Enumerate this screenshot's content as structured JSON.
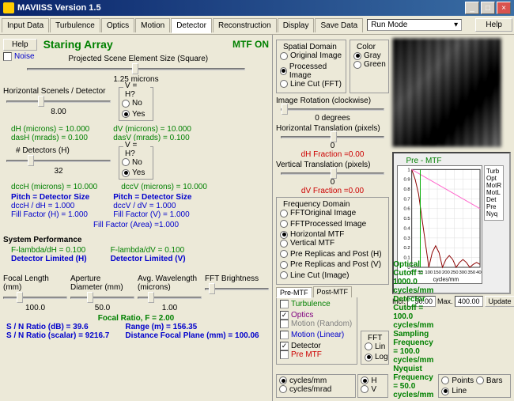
{
  "window": {
    "title": "MAVIISS Version 1.5",
    "help": "Help"
  },
  "tabs": [
    "Input Data",
    "Turbulence",
    "Optics",
    "Motion",
    "Detector",
    "Reconstruction",
    "Display",
    "Save Data"
  ],
  "active_tab": "Detector",
  "runmode": "Run Mode",
  "left": {
    "help": "Help",
    "title": "Staring Array",
    "mtf": "MTF ON",
    "noise": "Noise",
    "projected_label": "Projected Scene Element Size (Square)",
    "projected_val": "1.25 microns",
    "h_scenels": "Horizontal Scenels / Detector",
    "vh_label": "V = H?",
    "vh_no": "No",
    "vh_yes": "Yes",
    "h_scenels_val": "8.00",
    "dH": "dH (microns) = 10.000",
    "dV": "dV (microns) = 10.000",
    "dasH": "dasH (mrads) = 0.100",
    "dasV": "dasV (mrads) = 0.100",
    "ndetectors": "# Detectors (H)",
    "ndetectors_val": "32",
    "dccH": "dccH (microns) = 10.000",
    "dccV": "dccV (microns) = 10.000",
    "pitchH": "Pitch = Detector Size",
    "pitchV": "Pitch = Detector Size",
    "ratioH": "dccH / dH = 1.000",
    "ratioV": "dccV / dV = 1.000",
    "ffH": "Fill Factor (H) = 1.000",
    "ffV": "Fill Factor (V) = 1.000",
    "ffA": "Fill Factor (Area) =1.000",
    "sysperf": "System Performance",
    "flH": "F-lambda/dH = 0.100",
    "flV": "F-lambda/dV = 0.100",
    "detlimH": "Detector Limited (H)",
    "detlimV": "Detector Limited (V)",
    "focal_label": "Focal Length (mm)",
    "focal_val": "100.0",
    "aperture_label": "Aperture Diameter (mm)",
    "aperture_val": "50.0",
    "wavelength_label": "Avg. Wavelength (microns)",
    "wavelength_val": "1.00",
    "fft_label": "FFT Brightness",
    "focal_ratio": "Focal Ratio, F = 2.00",
    "sn_db": "S / N Ratio (dB) = 39.6",
    "sn_scalar": "S / N Ratio (scalar) = 9216.7",
    "range": "Range (m) = 156.35",
    "dfp": "Distance Focal Plane (mm) = 100.06"
  },
  "spatial": {
    "title": "Spatial Domain",
    "orig": "Original Image",
    "proc": "Processed Image",
    "line": "Line Cut (FFT)",
    "color": "Color",
    "gray": "Gray",
    "green": "Green"
  },
  "rotation": {
    "title": "Image Rotation (clockwise)",
    "val": "0 degrees",
    "ht_title": "Horizontal Translation (pixels)",
    "ht_val": "0",
    "dh_frac": "dH Fraction =0.00",
    "vt_title": "Vertical Translation (pixels)",
    "vt_val": "0",
    "dv_frac": "dV Fraction =0.00"
  },
  "freq": {
    "title": "Frequency Domain",
    "o1": "FFTOriginal Image",
    "o2": "FFTProcessed Image",
    "o3": "Horizontal MTF",
    "o4": "Vertical MTF",
    "o5": "Pre Replicas and Post (H)",
    "o6": "Pre Replicas and Post (V)",
    "o7": "Line Cut (Image)"
  },
  "premtf": {
    "tab1": "Pre-MTF",
    "tab2": "Post-MTF",
    "turb": "Turbulence",
    "optics": "Optics",
    "motion_r": "Motion (Random)",
    "motion_l": "Motion (Linear)",
    "detector": "Detector",
    "pre": "Pre MTF"
  },
  "fft": {
    "title": "FFT",
    "lin": "Lin",
    "log": "Log"
  },
  "chart_title": "Pre - MTF",
  "chart_legend": [
    "Turb",
    "Opt",
    "MotR",
    "MotL",
    "Det",
    "Pre",
    "Nyq"
  ],
  "chart_data": {
    "type": "line",
    "xlabel": "cycles/mm",
    "ylabel": "",
    "xlim": [
      0,
      400
    ],
    "ylim": [
      0,
      1
    ],
    "xticks": [
      0,
      50,
      100,
      150,
      200,
      250,
      300,
      350,
      400
    ],
    "yticks": [
      0,
      0.1,
      0.2,
      0.3,
      0.4,
      0.5,
      0.6,
      0.7,
      0.8,
      0.9,
      1
    ],
    "series": [
      {
        "name": "Det/Pre",
        "color": "#8b0000",
        "x": [
          0,
          20,
          40,
          60,
          80,
          100,
          120,
          140,
          160,
          180,
          200,
          220,
          240,
          260,
          280,
          300,
          320,
          340,
          360,
          380,
          400
        ],
        "y": [
          1,
          0.9,
          0.75,
          0.5,
          0.25,
          0,
          0.15,
          0.22,
          0.15,
          0,
          0.08,
          0.12,
          0.08,
          0,
          0.05,
          0.08,
          0.05,
          0,
          0.03,
          0.05,
          0.03
        ]
      },
      {
        "name": "Opt",
        "color": "#ff66cc",
        "x": [
          0,
          400
        ],
        "y": [
          1,
          0.6
        ]
      },
      {
        "name": "Nyq",
        "color": "#00aa00",
        "x": [
          50,
          50
        ],
        "y": [
          0,
          1
        ]
      }
    ]
  },
  "incr_label": "Incr.",
  "incr_val": "50.00",
  "max_label": "Max.",
  "max_val": "400.00",
  "update": "Update",
  "cutoff": {
    "opt": "Optical Cutoff = 1000.0 cycles/mm",
    "det": "Detector Cutoff = 100.0 cycles/mm",
    "samp": "Sampling Frequency = 100.0 cycles/mm",
    "nyq": "Nyquist Frequency = 50.0 cycles/mm"
  },
  "units": {
    "cpmm": "cycles/mm",
    "cpmrad": "cycles/mrad",
    "H": "H",
    "V": "V"
  },
  "plot_opts": {
    "points": "Points",
    "bars": "Bars",
    "line": "Line"
  }
}
